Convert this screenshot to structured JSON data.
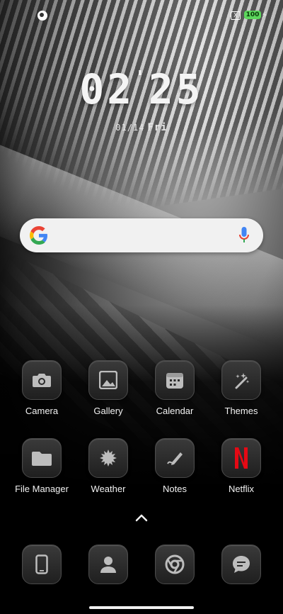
{
  "status_bar": {
    "left_icon": "notification-dot-icon",
    "sim_label": "X",
    "battery_level": "100",
    "battery_color": "#5cd65c",
    "charging_icon": "bolt-icon"
  },
  "clock": {
    "hours": "02",
    "separator": "'",
    "minutes": "25",
    "date": "01/14",
    "weekday": "Fri"
  },
  "search_bar": {
    "logo": "G",
    "logo_icon": "google-logo-icon",
    "mic_icon": "microphone-icon"
  },
  "apps_row1": [
    {
      "label": "Camera",
      "icon": "camera-icon"
    },
    {
      "label": "Gallery",
      "icon": "gallery-icon"
    },
    {
      "label": "Calendar",
      "icon": "calendar-icon"
    },
    {
      "label": "Themes",
      "icon": "magic-wand-icon"
    }
  ],
  "apps_row2": [
    {
      "label": "File Manager",
      "icon": "folder-icon"
    },
    {
      "label": "Weather",
      "icon": "weather-leaf-icon"
    },
    {
      "label": "Notes",
      "icon": "pen-icon"
    },
    {
      "label": "Netflix",
      "icon": "netflix-icon",
      "accent": "#e50914"
    }
  ],
  "dock": [
    {
      "icon": "phone-icon"
    },
    {
      "icon": "contacts-icon"
    },
    {
      "icon": "chrome-icon"
    },
    {
      "icon": "messages-icon"
    }
  ],
  "drawer_icon": "chevron-up-icon"
}
